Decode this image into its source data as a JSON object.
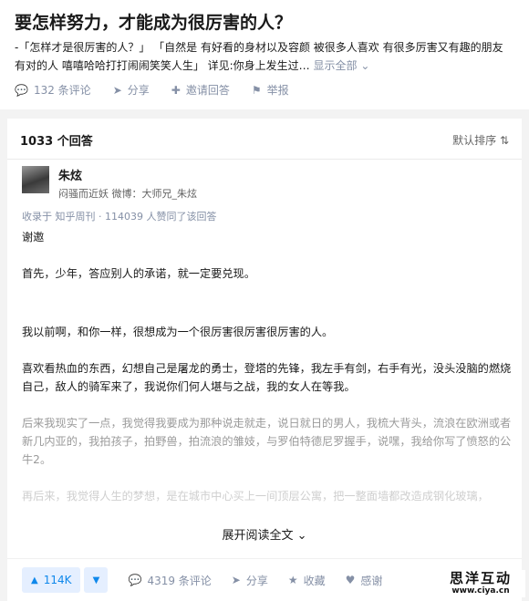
{
  "question": {
    "title": "要怎样努力，才能成为很厉害的人？",
    "detail": "-「怎样才是很厉害的人？」 「自然是 有好看的身材以及容颜 被很多人喜欢 有很多厉害又有趣的朋友 有对的人 嘻嘻哈哈打打闹闹笑笑人生」 详见:你身上发生过…",
    "show_all": "显示全部",
    "actions": {
      "comments": "132 条评论",
      "share": "分享",
      "invite": "邀请回答",
      "report": "举报"
    }
  },
  "answers": {
    "count": "1033 个回答",
    "sort": "默认排序"
  },
  "answer": {
    "author_name": "朱炫",
    "author_bio": "闷骚而近妖 微博：大师兄_朱炫",
    "meta": "收录于 知乎周刊 · 114039 人赞同了该回答",
    "paragraphs": [
      "谢邀",
      "首先，少年，答应别人的承诺，就一定要兑现。",
      "我以前啊，和你一样，很想成为一个很厉害很厉害很厉害的人。",
      "喜欢看热血的东西，幻想自己是屠龙的勇士，登塔的先锋，我左手有剑，右手有光，没头没脑的燃烧自己，敌人的骑军来了，我说你们何人堪与之战，我的女人在等我。",
      "后来我现实了一点，我觉得我要成为那种说走就走，说日就日的男人，我梳大背头，流浪在欧洲或者新几内亚的，我拍孩子，拍野兽，拍流浪的雏妓，与罗伯特德尼罗握手，说嘿，我给你写了愤怒的公牛2。",
      "再后来，我觉得人生的梦想，是在城市中心买上一间顶层公寓，把一整面墙都改造成钢化玻璃，"
    ],
    "expand": "展开阅读全文",
    "bottom": {
      "votes": "114K",
      "comments": "4319 条评论",
      "share": "分享",
      "collect": "收藏",
      "thanks": "感谢"
    }
  },
  "watermark": {
    "name": "思洋互动",
    "url": "www.ciya.cn"
  }
}
